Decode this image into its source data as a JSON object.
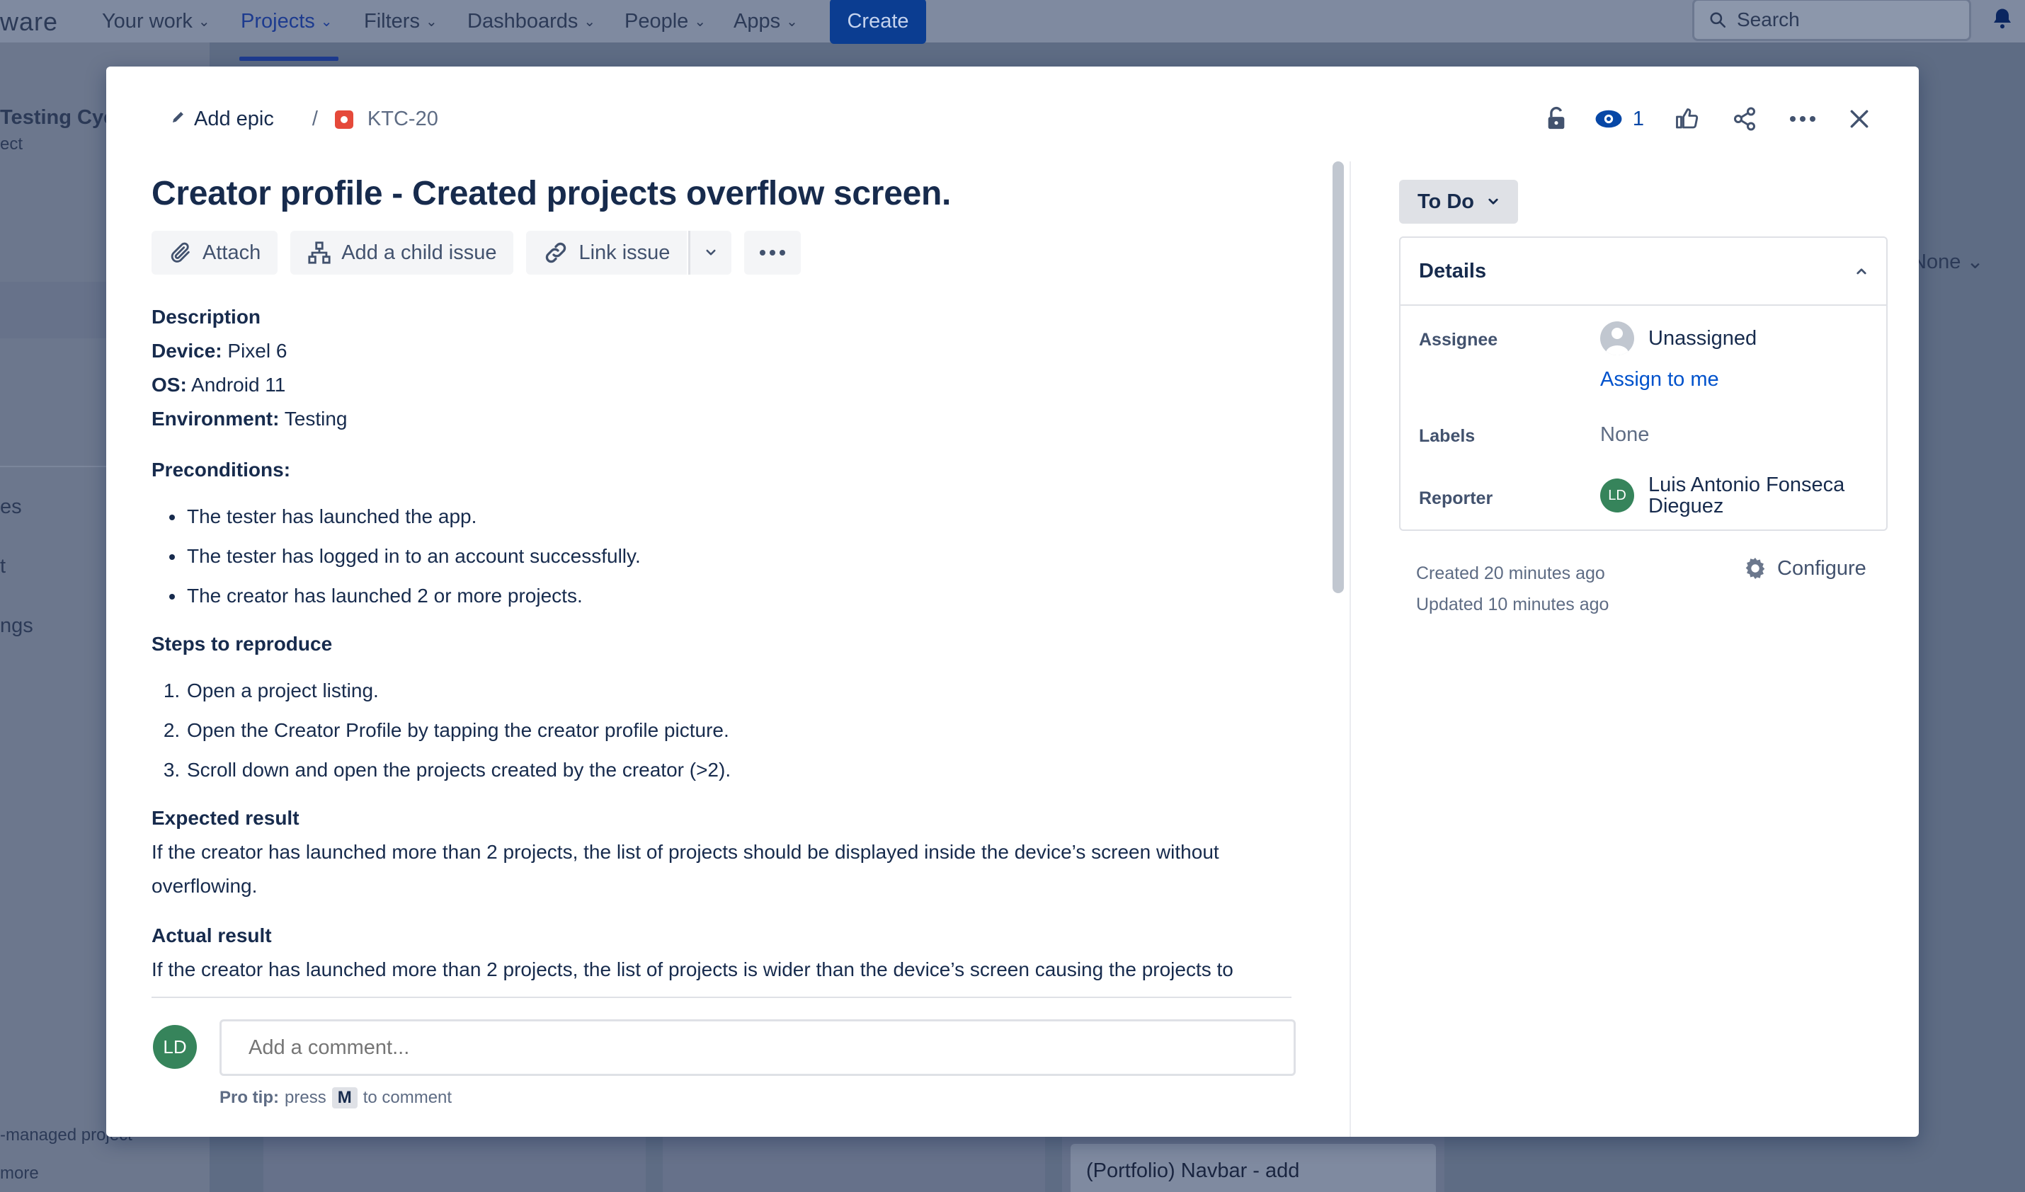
{
  "topnav": {
    "brand": "ware",
    "items": [
      "Your work",
      "Projects",
      "Filters",
      "Dashboards",
      "People",
      "Apps"
    ],
    "create_label": "Create",
    "search_placeholder": "Search"
  },
  "bg": {
    "sidebar_title": "Testing Cyc",
    "sidebar_sub": "ect",
    "sidebar_items": [
      "es",
      "t",
      "ngs"
    ],
    "footer_1": "-managed project",
    "footer_2": "more",
    "none_label": "None",
    "card_title": "(Portfolio) Navbar - add"
  },
  "issue": {
    "add_epic": "Add epic",
    "separator": "/",
    "key": "KTC-20",
    "watch_count": "1",
    "title": "Creator profile - Created projects overflow screen.",
    "toolbar": {
      "attach": "Attach",
      "child": "Add a child issue",
      "link": "Link issue"
    },
    "description": {
      "heading": "Description",
      "device_label": "Device:",
      "device": "Pixel 6",
      "os_label": "OS:",
      "os": "Android 11",
      "env_label": "Environment:",
      "env": "Testing",
      "pre_heading": "Preconditions:",
      "preconditions": [
        "The tester has launched the app.",
        "The tester has logged in to an account successfully.",
        "The creator has launched 2 or more projects."
      ],
      "steps_heading": "Steps to reproduce",
      "steps": [
        "Open a project listing.",
        "Open the Creator Profile by tapping the creator profile picture.",
        "Scroll down and open the projects created by the creator (>2)."
      ],
      "expected_heading": "Expected result",
      "expected": "If the creator has launched more than 2 projects, the list of projects should be displayed inside the device’s screen without overflowing.",
      "actual_heading": "Actual result",
      "actual": "If the creator has launched more than 2 projects, the list of projects is wider than the device’s screen causing the projects to"
    },
    "comment": {
      "avatar": "LD",
      "placeholder": "Add a comment...",
      "protip_label": "Pro tip:",
      "protip_press": "press",
      "protip_key": "M",
      "protip_end": "to comment"
    },
    "status": "To Do",
    "details": {
      "heading": "Details",
      "assignee_label": "Assignee",
      "assignee": "Unassigned",
      "assign_me": "Assign to me",
      "labels_label": "Labels",
      "labels": "None",
      "reporter_label": "Reporter",
      "reporter_avatar": "LD",
      "reporter_line1": "Luis Antonio Fonseca",
      "reporter_line2": "Dieguez"
    },
    "created": "Created 20 minutes ago",
    "updated": "Updated 10 minutes ago",
    "configure": "Configure"
  }
}
